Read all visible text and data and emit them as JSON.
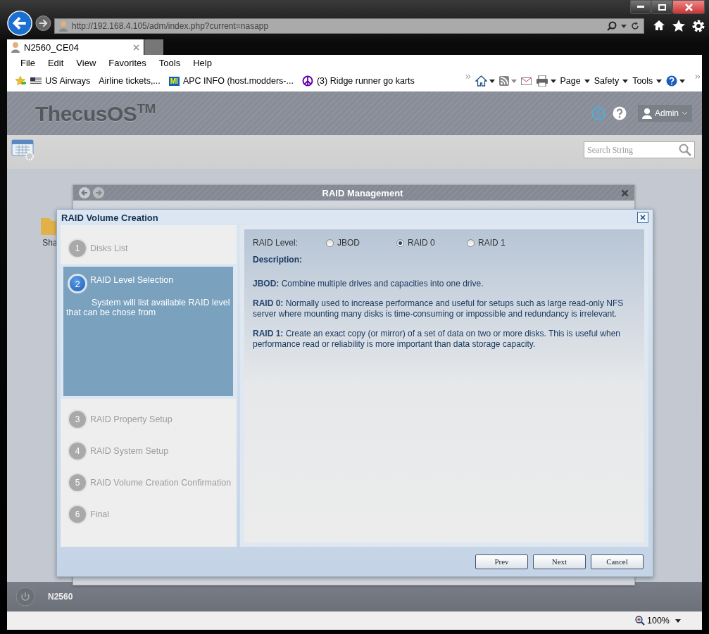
{
  "browser": {
    "address": "http://192.168.4.105/adm/index.php?current=nasapp",
    "tab": "N2560_CE04",
    "menu": [
      "File",
      "Edit",
      "View",
      "Favorites",
      "Tools",
      "Help"
    ],
    "favorites": [
      {
        "kind": "flag",
        "label": "US Airways"
      },
      {
        "kind": "plain",
        "label": "Airline tickets,..."
      },
      {
        "kind": "badge",
        "badge": "MI",
        "label": "APC INFO (host.modders-..."
      },
      {
        "kind": "peace",
        "label": "(3) Ridge runner go karts"
      }
    ],
    "commands": [
      "Page",
      "Safety",
      "Tools"
    ],
    "zoom": "100%"
  },
  "app": {
    "logo": "ThecusOS$^{TM}$",
    "user": "Admin",
    "search_placeholder": "Search String",
    "desktop_icon": "Sha",
    "window_title": "RAID Management",
    "device": "N2560"
  },
  "dialog": {
    "title": "RAID Volume Creation",
    "steps": [
      {
        "number": "1",
        "label": "Disks List",
        "selected": false
      },
      {
        "number": "2",
        "label": "RAID Level Selection",
        "selected": true,
        "description": "System will list available RAID level that can be chose from"
      },
      {
        "number": "3",
        "label": "RAID Property Setup",
        "selected": false
      },
      {
        "number": "4",
        "label": "RAID System Setup",
        "selected": false
      },
      {
        "number": "5",
        "label": "RAID Volume Creation Confirmation",
        "selected": false
      },
      {
        "number": "6",
        "label": "Final",
        "selected": false
      }
    ],
    "raid_level": {
      "label": "RAID Level:",
      "options": [
        {
          "label": "JBOD",
          "selected": false
        },
        {
          "label": "RAID 0",
          "selected": true
        },
        {
          "label": "RAID 1",
          "selected": false
        }
      ]
    },
    "description_heading": "Description:",
    "descriptions": [
      "**JBOD:** Combine multiple drives and capacities into one drive.",
      "**RAID 0:** Normally used to increase performance and useful for setups such as large read-only NFS server where mounting many disks is time-consuming or impossible and redundancy is irrelevant.",
      "**RAID 1:** Create an exact copy (or mirror) of a set of data on two or more disks. This is useful when performance read or reliability is more important than data storage capacity."
    ],
    "buttons": [
      "Prev",
      "Next",
      "Cancel"
    ]
  }
}
